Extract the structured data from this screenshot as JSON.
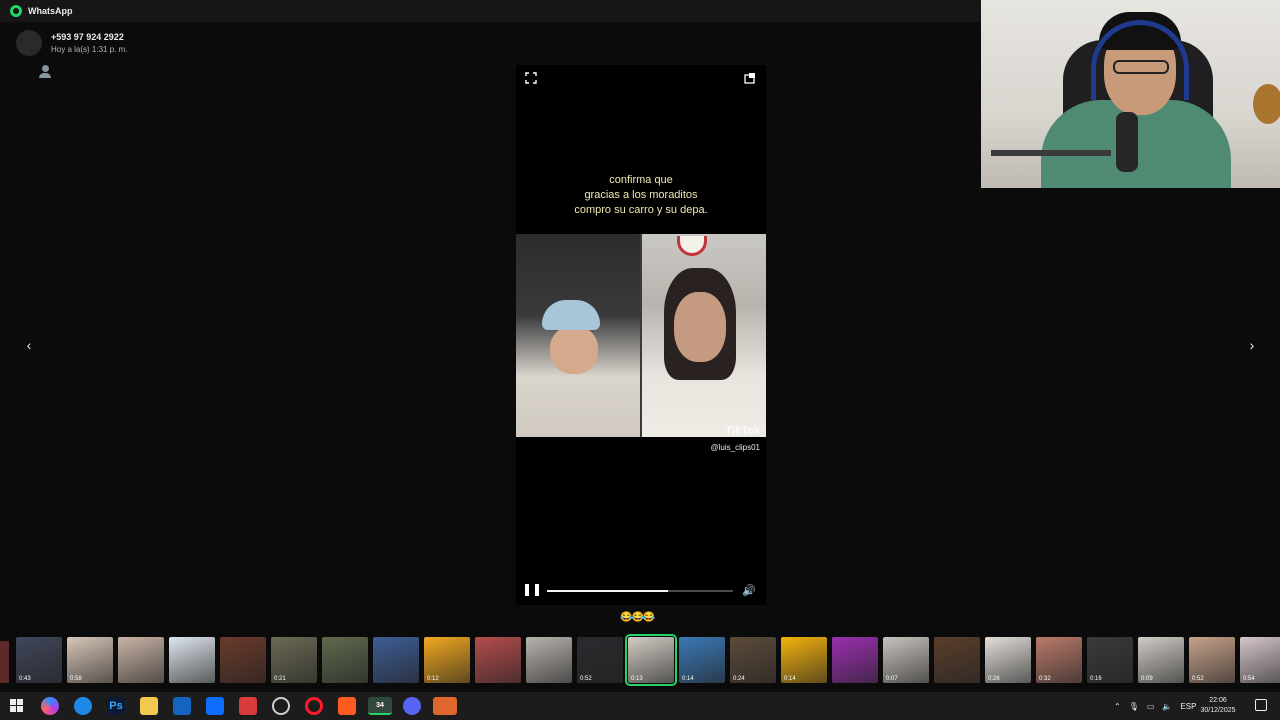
{
  "window": {
    "title": "WhatsApp"
  },
  "contact": {
    "name": "+593 97 924 2922",
    "timestamp": "Hoy a la(s) 1:31 p. m."
  },
  "viewer": {
    "caption_lines": [
      "confirma que",
      "gracias a los moraditos",
      "compro su carro y su depa."
    ],
    "watermark": "TikTok",
    "handle": "@luis_clips01",
    "progress": 0.65,
    "reactions": "😂😂😂"
  },
  "thumbnails": [
    {
      "duration": "0:43",
      "color": "#40465a"
    },
    {
      "duration": "0:58",
      "color": "#d8c6b8"
    },
    {
      "duration": "",
      "color": "#c9b4a6"
    },
    {
      "duration": "",
      "color": "#dfe6ee"
    },
    {
      "duration": "",
      "color": "#6a3a2a"
    },
    {
      "duration": "0:21",
      "color": "#6c6a55"
    },
    {
      "duration": "",
      "color": "#5f6a4e"
    },
    {
      "duration": "",
      "color": "#3e5d95"
    },
    {
      "duration": "0:12",
      "color": "#f2a81f"
    },
    {
      "duration": "",
      "color": "#b54d4d"
    },
    {
      "duration": "",
      "color": "#b8b3ad"
    },
    {
      "duration": "0:52",
      "color": "#2a2b2e"
    },
    {
      "duration": "0:13",
      "color": "#d1ccc4"
    },
    {
      "duration": "0:14",
      "color": "#3a78b5"
    },
    {
      "duration": "0:24",
      "color": "#5c4b3a"
    },
    {
      "duration": "0:14",
      "color": "#f4b20d"
    },
    {
      "duration": "",
      "color": "#9b2fb0"
    },
    {
      "duration": "0:07",
      "color": "#c8c3bd"
    },
    {
      "duration": "",
      "color": "#5a3e2b"
    },
    {
      "duration": "0:26",
      "color": "#e3dfda"
    },
    {
      "duration": "0:32",
      "color": "#b97a6a"
    },
    {
      "duration": "0:16",
      "color": "#3a3a3a"
    },
    {
      "duration": "0:09",
      "color": "#d0ccc6"
    },
    {
      "duration": "0:52",
      "color": "#c7a28a"
    },
    {
      "duration": "0:54",
      "color": "#d5c6c9"
    }
  ],
  "taskbar": {
    "photoshop_label": "Ps",
    "whatsapp_badge": "34",
    "tray": {
      "language": "ESP"
    },
    "clock": {
      "time": "22:06",
      "date": "30/12/2025"
    }
  },
  "colors": {
    "accent": "#25d366",
    "background": "#0b0b0b"
  }
}
